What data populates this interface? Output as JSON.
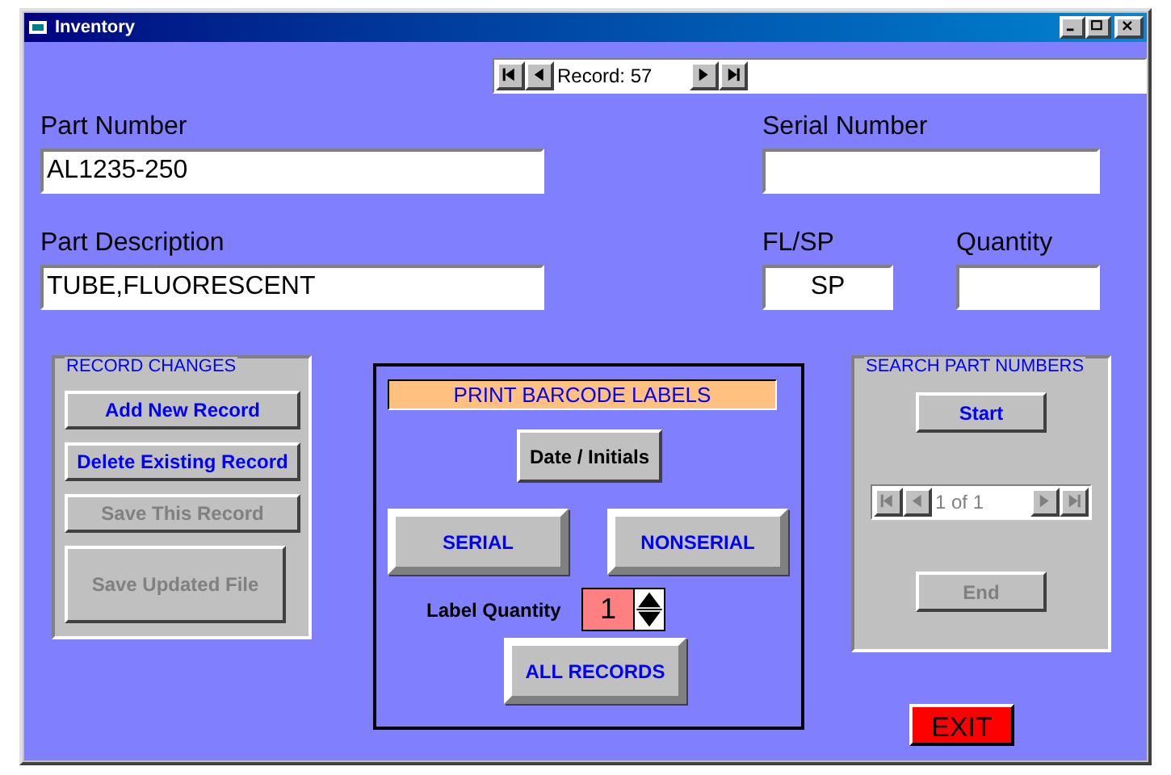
{
  "window": {
    "title": "Inventory"
  },
  "record_navigator": {
    "text": "Record: 57"
  },
  "part_number": {
    "label": "Part Number",
    "value": "AL1235-250"
  },
  "serial_number": {
    "label": "Serial Number"
  },
  "part_description": {
    "label": "Part Description",
    "value": "TUBE,FLUORESCENT"
  },
  "fl_sp": {
    "label": "FL/SP",
    "value": "SP"
  },
  "quantity": {
    "label": "Quantity"
  },
  "record_changes": {
    "title": "RECORD CHANGES",
    "buttons": [
      {
        "label": "Add New Record",
        "disabled": false
      },
      {
        "label": "Delete Existing Record",
        "disabled": false
      },
      {
        "label": "Save This Record",
        "disabled": true
      },
      {
        "label": "Save Updated File",
        "disabled": true
      }
    ]
  },
  "print_labels": {
    "title": "PRINT BARCODE LABELS",
    "date_button": "Date / Initials",
    "serial_button": "SERIAL",
    "nonserial_button": "NONSERIAL",
    "quantity_label": "Label Quantity",
    "quantity_value": "1",
    "all_records_button": "ALL RECORDS"
  },
  "search": {
    "title": "SEARCH PART NUMBERS",
    "start": {
      "label": "Start",
      "disabled": false
    },
    "navigator": {
      "text": "1 of 1",
      "disabled": true
    },
    "end": {
      "label": "End",
      "disabled": true
    }
  },
  "exit_button": "EXIT"
}
